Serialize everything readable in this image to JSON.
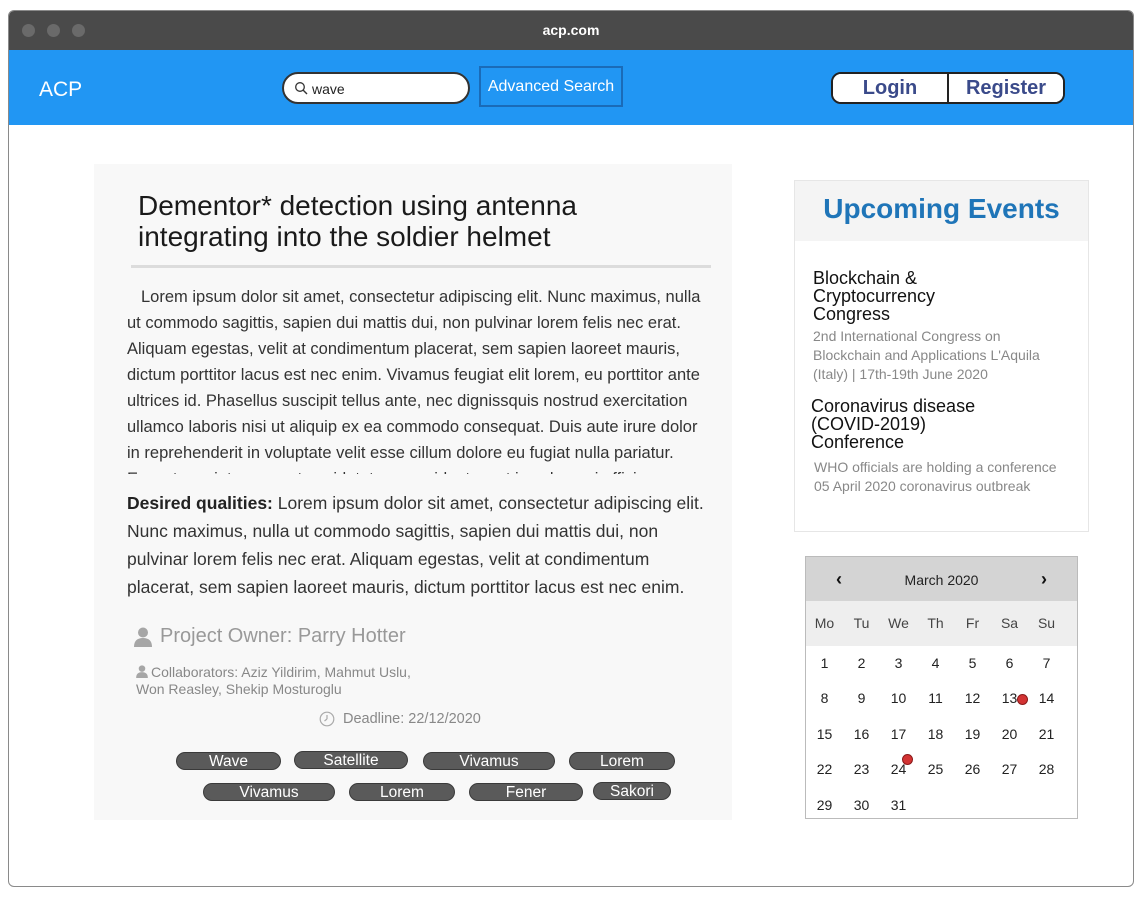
{
  "browser": {
    "url": "acp.com"
  },
  "navbar": {
    "brand": "ACP",
    "search_value": "wave",
    "advanced_search": "Advanced Search",
    "login": "Login",
    "register": "Register"
  },
  "article": {
    "title": "Dementor* detection using antenna integrating into the soldier helmet",
    "body": "Lorem ipsum dolor sit amet, consectetur adipiscing elit. Nunc maximus, nulla ut commodo sagittis, sapien dui mattis dui, non pulvinar lorem felis nec erat. Aliquam egestas, velit at condimentum placerat, sem sapien laoreet mauris, dictum porttitor lacus est nec enim. Vivamus feugiat elit lorem, eu porttitor ante ultrices id. Phasellus suscipit tellus ante, nec dignissquis nostrud exercitation ullamco laboris nisi ut aliquip ex ea commodo consequat. Duis aute irure dolor in reprehenderit in voluptate velit esse cillum dolore eu fugiat nulla pariatur. Excepteur sint occaecat cupidatat non proident, sunt in culpa qui officia.",
    "qualities_label": "Desired qualities:",
    "qualities_text": " Lorem ipsum dolor sit amet, consectetur adipiscing elit. Nunc maximus, nulla ut commodo sagittis, sapien dui mattis dui, non pulvinar lorem felis nec erat. Aliquam egestas, velit at condimentum placerat, sem sapien laoreet mauris, dictum porttitor lacus est nec enim.",
    "owner": "Project Owner: Parry Hotter",
    "collaborators": "Collaborators: Aziz Yildirim, Mahmut Uslu, Won Reasley, Shekip Mosturoglu",
    "deadline": "Deadline: 22/12/2020",
    "tags": [
      "Wave",
      "Satellite",
      "Vivamus",
      "Lorem",
      "Vivamus",
      "Lorem",
      "Fener",
      "Sakori"
    ]
  },
  "events": {
    "heading": "Upcoming Events",
    "items": [
      {
        "title": "Blockchain & Cryptocurrency Congress",
        "description": "2nd International Congress on Blockchain and Applications L'Aquila (Italy) | 17th-19th June 2020"
      },
      {
        "title": "Coronavirus disease (COVID-2019) Conference",
        "description": "WHO officials are holding a conference 05 April 2020 coronavirus outbreak"
      }
    ]
  },
  "calendar": {
    "month": "March 2020",
    "prev": "‹",
    "next": "›",
    "weekdays": [
      "Mo",
      "Tu",
      "We",
      "Th",
      "Fr",
      "Sa",
      "Su"
    ],
    "weeks": [
      [
        "1",
        "2",
        "3",
        "4",
        "5",
        "6",
        "7"
      ],
      [
        "8",
        "9",
        "10",
        "11",
        "12",
        "13",
        "14"
      ],
      [
        "15",
        "16",
        "17",
        "18",
        "19",
        "20",
        "21"
      ],
      [
        "22",
        "23",
        "24",
        "25",
        "26",
        "27",
        "28"
      ],
      [
        "29",
        "30",
        "31",
        "",
        "",
        "",
        ""
      ]
    ],
    "event_days": [
      "13",
      "24"
    ],
    "event_color": "#d33333"
  }
}
